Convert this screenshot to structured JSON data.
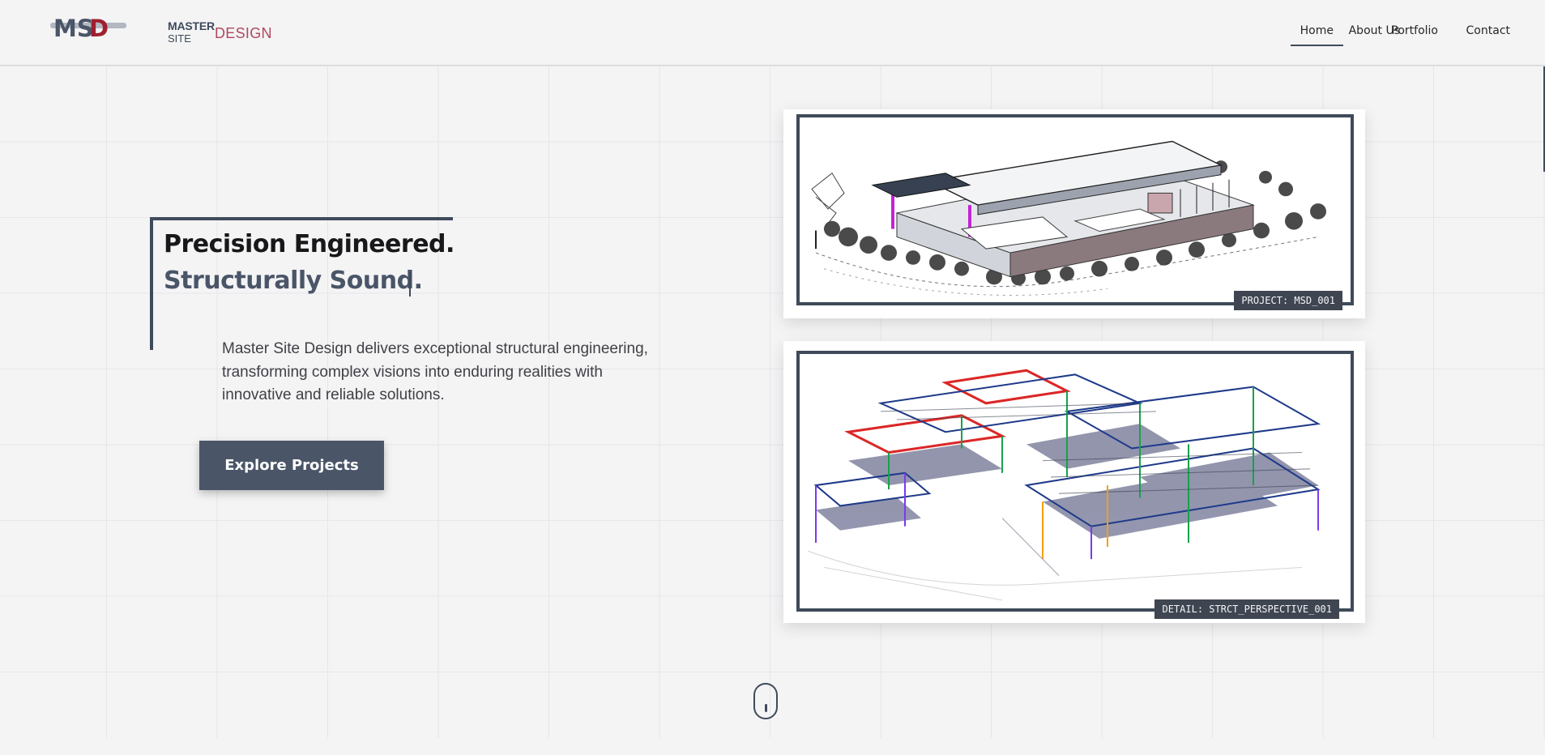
{
  "brand": {
    "mark": "MSD",
    "master": "MASTER",
    "site": "SITE",
    "design": "DESIGN",
    "colors": {
      "primary": "#3f4a5a",
      "accent": "#b0485e",
      "mark_red": "#a0202f"
    }
  },
  "nav": {
    "items": [
      {
        "label": "Home",
        "active": true
      },
      {
        "label": "About Us",
        "active": false
      },
      {
        "label": "Portfolio",
        "active": false
      },
      {
        "label": "Contact",
        "active": false
      }
    ]
  },
  "hero": {
    "title_line1": "Precision Engineered.",
    "title_line2": "Structurally Sound.",
    "description": "Master Site Design delivers exceptional structural engineering, transforming complex visions into enduring realities with innovative and reliable solutions.",
    "cta_label": "Explore Projects"
  },
  "projects": [
    {
      "label": "PROJECT: MSD_001",
      "image": "isometric-house-rendering"
    },
    {
      "label": "DETAIL: STRCT_PERSPECTIVE_001",
      "image": "structural-frame-perspective"
    }
  ],
  "scroll_indicator": {
    "icon": "mouse-scroll-icon"
  }
}
